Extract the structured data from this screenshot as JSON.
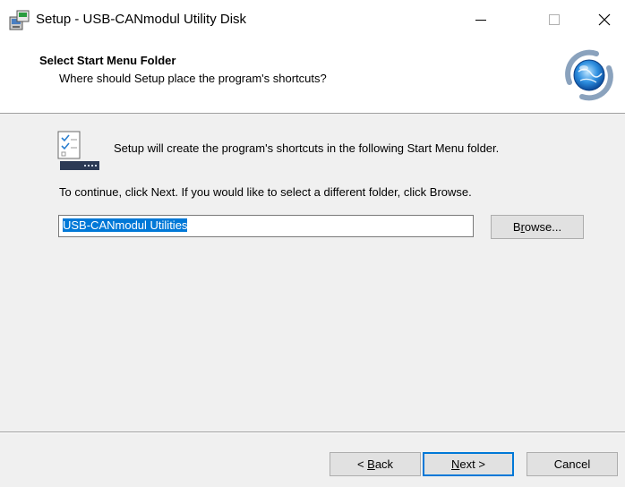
{
  "window": {
    "title": "Setup - USB-CANmodul Utility Disk",
    "controls": {
      "minimize_icon": "minimize-icon",
      "maximize_icon": "maximize-icon",
      "close_icon": "close-icon"
    }
  },
  "header": {
    "title": "Select Start Menu Folder",
    "subtitle": "Where should Setup place the program's shortcuts?"
  },
  "body": {
    "intro": "Setup will create the program's shortcuts in the following Start Menu folder.",
    "instructions": "To continue, click Next. If you would like to select a different folder, click Browse.",
    "folder_value": "USB-CANmodul Utilities",
    "browse": {
      "prefix": "B",
      "accel": "r",
      "suffix": "owse..."
    }
  },
  "footer": {
    "back": {
      "prefix": "< ",
      "accel": "B",
      "suffix": "ack"
    },
    "next": {
      "prefix": "",
      "accel": "N",
      "suffix": "ext >"
    },
    "cancel": "Cancel"
  },
  "colors": {
    "selection": "#0078d7",
    "focus_border": "#0078d7",
    "window_bg": "#f0f0f0"
  }
}
